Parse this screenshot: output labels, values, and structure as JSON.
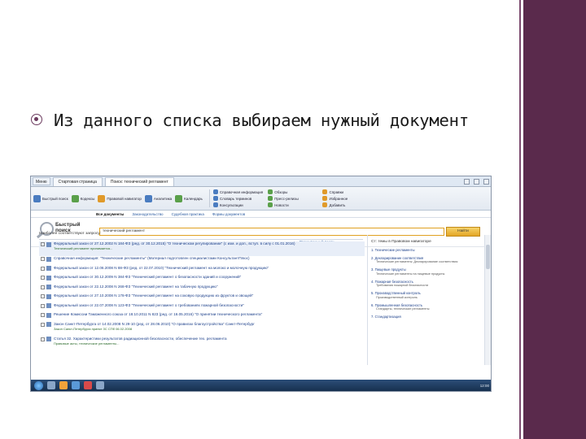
{
  "bullet_text": "Из данного списка выбираем нужный документ",
  "app": {
    "menu_label": "Меню",
    "tabs": [
      "Стартовая страница",
      "Поиск: технический регламент"
    ]
  },
  "toolbar": {
    "buttons": [
      "Быстрый поиск",
      "Кодексы",
      "Правовой навигатор",
      "Аналитика",
      "Календарь"
    ],
    "group": [
      "Справочная информация",
      "Обзоры",
      "Справки",
      "Словарь терминов",
      "Пресс-релизы",
      "Избранное",
      "Консультации",
      "Новости",
      "Добавить"
    ]
  },
  "nav": [
    "Все документы",
    "Законодательство",
    "Судебная практика",
    "Формы документов"
  ],
  "search": {
    "logo_line1": "Быстрый",
    "logo_line2": "поиск",
    "query": "технический регламент",
    "go_label": "Найти",
    "extend_label": "Расширенный поиск"
  },
  "results_label": "Наиболее соответствуют запросу:",
  "results": [
    {
      "text": "Федеральный закон от 27.12.2002 N 184-ФЗ (ред. от 30.12.2015) \"О техническом регулировании\" (с изм. и доп., вступ. в силу с 01.01.2016)",
      "sub": "Технический регламент принимается..."
    },
    {
      "text": "Справочная информация: \"Технические регламенты\" (Материал подготовлен специалистами КонсультантПлюс)",
      "sub": ""
    },
    {
      "text": "Федеральный закон от 12.06.2008 N 88-ФЗ (ред. от 22.07.2010) \"Технический регламент на молоко и молочную продукцию\"",
      "sub": ""
    },
    {
      "text": "Федеральный закон от 30.12.2009 N 384-ФЗ \"Технический регламент о безопасности зданий и сооружений\"",
      "sub": ""
    },
    {
      "text": "Федеральный закон от 22.12.2008 N 268-ФЗ \"Технический регламент на табачную продукцию\"",
      "sub": ""
    },
    {
      "text": "Федеральный закон от 27.10.2008 N 178-ФЗ \"Технический регламент на соковую продукцию из фруктов и овощей\"",
      "sub": ""
    },
    {
      "text": "Федеральный закон от 22.07.2008 N 123-ФЗ \"Технический регламент о требованиях пожарной безопасности\"",
      "sub": ""
    },
    {
      "text": "Решение Комиссии Таможенного союза от 18.10.2011 N 823 (ред. от 16.05.2016) \"О принятии технического регламента\"",
      "sub": ""
    },
    {
      "text": "Закон Санкт-Петербурга от 14.02.2008 N 29-10 (ред. от 28.06.2010) \"О правилах благоустройства\" Санкт-Петербург",
      "sub": "Закон Санкт-Петербурга принят ЗС СПб 06.02.2008"
    },
    {
      "text": "Статья 32. Характеристики результатов радиационной безопасности, обеспечение тех. регламента",
      "sub": "Правовые акты, технические регламенты..."
    }
  ],
  "side_panel": {
    "title": "Ст: темы в Правовом навигаторе",
    "items": [
      {
        "head": "1. Технические регламенты",
        "sub": ""
      },
      {
        "head": "2. Декларирование соответствия",
        "sub": "Технические регламенты: Декларирование соответствия"
      },
      {
        "head": "3. Пищевые продукты",
        "sub": "Технические регламенты на пищевые продукты"
      },
      {
        "head": "4. Пожарная безопасность",
        "sub": "Требования пожарной безопасности"
      },
      {
        "head": "5. Производственный контроль",
        "sub": "Производственный контроль"
      },
      {
        "head": "6. Промышленная безопасность",
        "sub": "Стандарты, технические регламенты"
      },
      {
        "head": "7. Стандартизация",
        "sub": ""
      }
    ]
  },
  "tray_time": "12:00"
}
